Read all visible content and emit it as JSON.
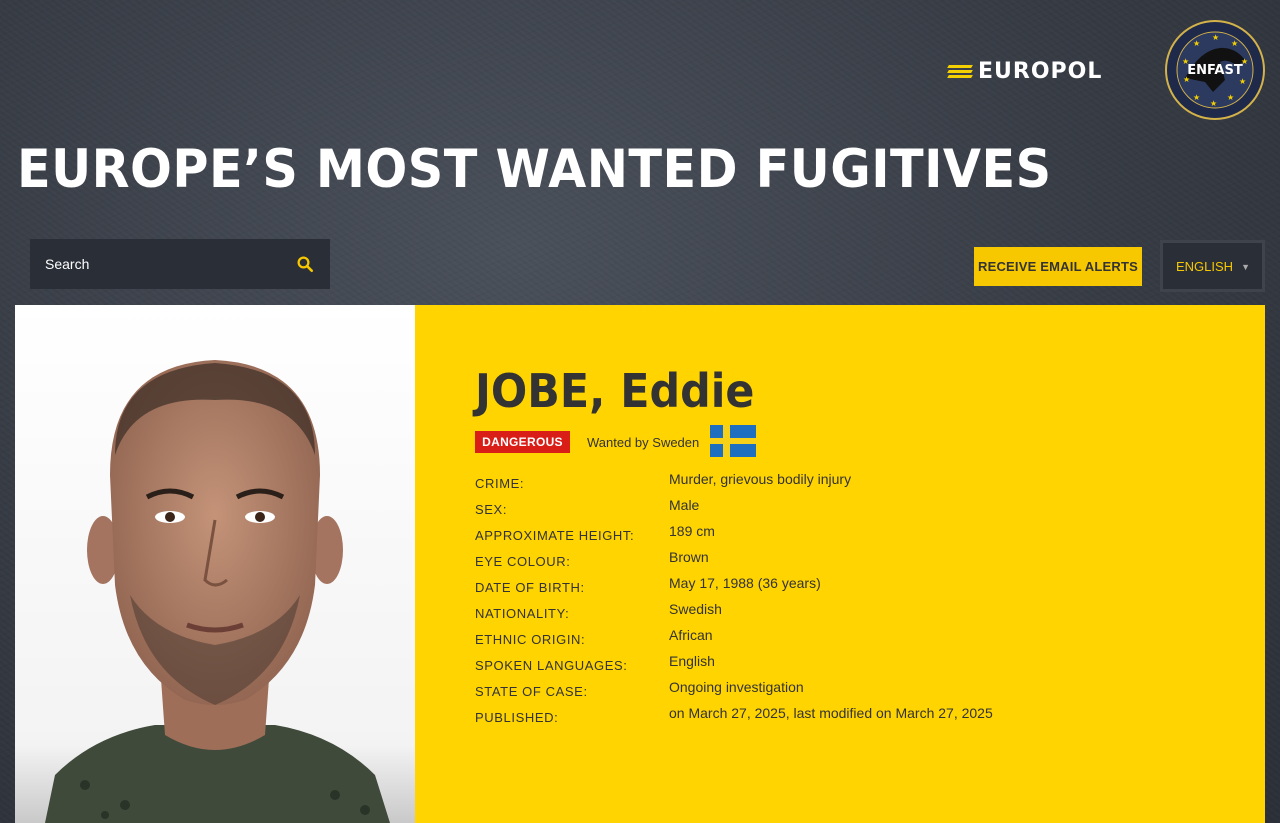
{
  "header": {
    "europol_logo_text": "EUROPOL",
    "enfast_logo_text": "ENFAST",
    "page_title": "EUROPE’S MOST WANTED FUGITIVES"
  },
  "search": {
    "placeholder": "Search",
    "icon": "search-icon"
  },
  "toolbar": {
    "email_alerts_label": "RECEIVE EMAIL ALERTS",
    "language_selected": "ENGLISH"
  },
  "fugitive": {
    "name": "JOBE, Eddie",
    "badge": "DANGEROUS",
    "wanted_by": "Wanted by Sweden",
    "flag_icon": "sweden-flag-icon",
    "fields": [
      {
        "label": "CRIME:",
        "value": "Murder, grievous bodily injury"
      },
      {
        "label": "SEX:",
        "value": "Male"
      },
      {
        "label": "APPROXIMATE HEIGHT:",
        "value": "189 cm"
      },
      {
        "label": "EYE COLOUR:",
        "value": "Brown"
      },
      {
        "label": "DATE OF BIRTH:",
        "value": "May 17, 1988 (36 years)"
      },
      {
        "label": "NATIONALITY:",
        "value": "Swedish"
      },
      {
        "label": "ETHNIC ORIGIN:",
        "value": "African"
      },
      {
        "label": "SPOKEN LANGUAGES:",
        "value": "English"
      },
      {
        "label": "STATE OF CASE:",
        "value": "Ongoing investigation"
      },
      {
        "label": "PUBLISHED:",
        "value": "on March 27, 2025, last modified on March 27, 2025"
      }
    ]
  },
  "colors": {
    "accent_yellow": "#ffd400",
    "danger_red": "#d91e18",
    "background_dark": "#363b44"
  }
}
